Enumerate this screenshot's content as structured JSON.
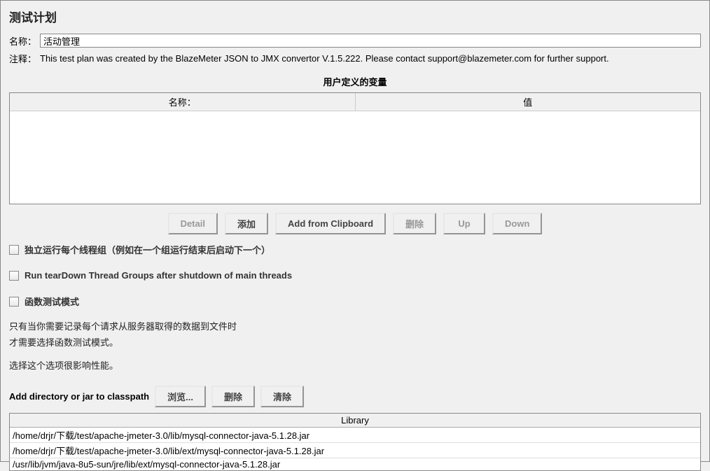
{
  "title": "测试计划",
  "name_field": {
    "label": "名称：",
    "value": "活动管理"
  },
  "comments_field": {
    "label": "注释：",
    "value": "This test plan was created by the BlazeMeter JSON to JMX convertor V.1.5.222. Please contact support@blazemeter.com for further support."
  },
  "variables_section": {
    "title": "用户定义的变量",
    "columns": [
      "名称：",
      "值"
    ],
    "buttons": {
      "detail": "Detail",
      "add": "添加",
      "add_clipboard": "Add from Clipboard",
      "delete": "删除",
      "up": "Up",
      "down": "Down"
    }
  },
  "checkboxes": {
    "independent": "独立运行每个线程组（例如在一个组运行结束后启动下一个）",
    "teardown": "Run tearDown Thread Groups after shutdown of main threads",
    "functional": "函数测试模式"
  },
  "helper": {
    "line1": "只有当你需要记录每个请求从服务器取得的数据到文件时",
    "line2": "才需要选择函数测试模式。",
    "line3": "选择这个选项很影响性能。"
  },
  "classpath": {
    "label": "Add directory or jar to classpath",
    "buttons": {
      "browse": "浏览...",
      "delete": "删除",
      "clear": "清除"
    },
    "header": "Library",
    "rows": [
      "/home/drjr/下载/test/apache-jmeter-3.0/lib/mysql-connector-java-5.1.28.jar",
      "/home/drjr/下载/test/apache-jmeter-3.0/lib/ext/mysql-connector-java-5.1.28.jar",
      "/usr/lib/jvm/java-8u5-sun/jre/lib/ext/mysql-connector-java-5.1.28.jar"
    ]
  }
}
